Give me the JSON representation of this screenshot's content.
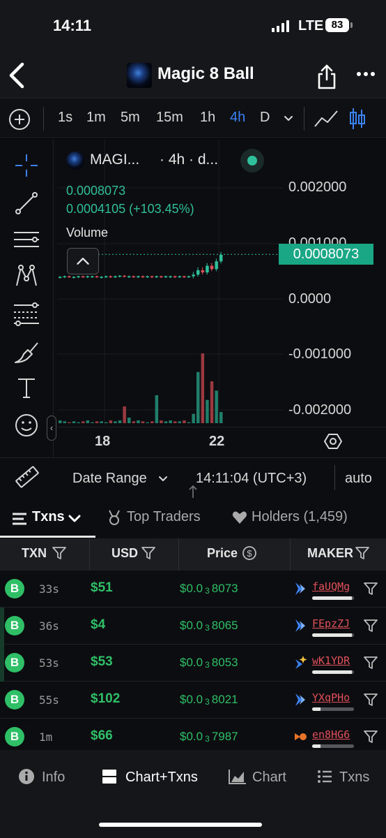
{
  "status_bar": {
    "time": "14:11",
    "network": "LTE",
    "battery": "83"
  },
  "header": {
    "title": "Magic 8 Ball"
  },
  "timeframes": {
    "items": [
      "1s",
      "1m",
      "5m",
      "15m",
      "1h",
      "4h",
      "D"
    ],
    "active": "4h"
  },
  "chart_legend": {
    "symbol": "MAGI...",
    "timeframe_info": "· 4h · d...",
    "price": "0.0008073",
    "change": "0.0004105 (+103.45%)",
    "volume_label": "Volume"
  },
  "chart_data": {
    "type": "candlestick",
    "price_axis_ticks": [
      "0.002000",
      "0.001000",
      "0.0000",
      "-0.001000",
      "-0.002000"
    ],
    "current_price_tag": "0.0008073",
    "x_tick_labels": [
      "18",
      "22"
    ],
    "candles_note": "flat near 0.0004 until date 22, then a spike to 0.0008073",
    "candles": [
      {
        "o": 0.0004,
        "c": 0.0004
      },
      {
        "o": 0.0004,
        "c": 0.00041
      },
      {
        "o": 0.00041,
        "c": 0.0004
      },
      {
        "o": 0.0004,
        "c": 0.0004
      },
      {
        "o": 0.0004,
        "c": 0.00041
      },
      {
        "o": 0.00041,
        "c": 0.0004
      },
      {
        "o": 0.0004,
        "c": 0.00041
      },
      {
        "o": 0.00041,
        "c": 0.00041
      },
      {
        "o": 0.00041,
        "c": 0.0004
      },
      {
        "o": 0.0004,
        "c": 0.0004
      },
      {
        "o": 0.0004,
        "c": 0.00041
      },
      {
        "o": 0.00041,
        "c": 0.0004
      },
      {
        "o": 0.0004,
        "c": 0.00041
      },
      {
        "o": 0.00041,
        "c": 0.00042
      },
      {
        "o": 0.00042,
        "c": 0.00041
      },
      {
        "o": 0.00041,
        "c": 0.00041
      },
      {
        "o": 0.00041,
        "c": 0.0004
      },
      {
        "o": 0.0004,
        "c": 0.00041
      },
      {
        "o": 0.00041,
        "c": 0.0004
      },
      {
        "o": 0.0004,
        "c": 0.00041
      },
      {
        "o": 0.00041,
        "c": 0.0004
      },
      {
        "o": 0.0004,
        "c": 0.00041
      },
      {
        "o": 0.00041,
        "c": 0.0004
      },
      {
        "o": 0.0004,
        "c": 0.00041
      },
      {
        "o": 0.00041,
        "c": 0.00041
      },
      {
        "o": 0.00041,
        "c": 0.0004
      },
      {
        "o": 0.0004,
        "c": 0.00041
      },
      {
        "o": 0.00041,
        "c": 0.0004
      },
      {
        "o": 0.0004,
        "c": 0.00041
      },
      {
        "o": 0.00041,
        "c": 0.00044
      },
      {
        "o": 0.00044,
        "c": 0.00052
      },
      {
        "o": 0.00052,
        "c": 0.00048
      },
      {
        "o": 0.00048,
        "c": 0.0006
      },
      {
        "o": 0.0006,
        "c": 0.00054
      },
      {
        "o": 0.00054,
        "c": 0.00068
      },
      {
        "o": 0.00068,
        "c": 0.0008
      }
    ],
    "volumes": [
      3,
      2,
      1,
      2,
      1,
      2,
      3,
      1,
      2,
      2,
      1,
      3,
      2,
      3,
      18,
      6,
      2,
      3,
      2,
      1,
      2,
      30,
      3,
      2,
      3,
      2,
      2,
      3,
      1,
      10,
      55,
      75,
      25,
      45,
      35,
      12
    ]
  },
  "range_bar": {
    "date_range": "Date Range",
    "clock": "14:11:04 (UTC+3)",
    "scale": "auto"
  },
  "tabs": [
    {
      "label": "Txns"
    },
    {
      "label": "Top Traders"
    },
    {
      "label": "Holders (1,459)"
    }
  ],
  "table": {
    "headers": [
      "TXN",
      "USD",
      "Price",
      "MAKER"
    ],
    "rows": [
      {
        "type": "B",
        "age": "33s",
        "usd": "$51",
        "price_prefix": "$0.0",
        "price_zeros": "3",
        "price_digits": "8073",
        "maker": "faUQMg",
        "maker_icon": "solana-icon",
        "bar": 0.95
      },
      {
        "type": "B",
        "age": "36s",
        "usd": "$4",
        "price_prefix": "$0.0",
        "price_zeros": "3",
        "price_digits": "8065",
        "maker": "FEpzZJ",
        "maker_icon": "solana-icon",
        "bar": 0.95
      },
      {
        "type": "B",
        "age": "53s",
        "usd": "$53",
        "price_prefix": "$0.0",
        "price_zeros": "3",
        "price_digits": "8053",
        "maker": "wK1YDR",
        "maker_icon": "sparkle-icon",
        "bar": 0.95
      },
      {
        "type": "B",
        "age": "55s",
        "usd": "$102",
        "price_prefix": "$0.0",
        "price_zeros": "3",
        "price_digits": "8021",
        "maker": "YXqPHo",
        "maker_icon": "solana-icon",
        "bar": 0.2
      },
      {
        "type": "B",
        "age": "1m",
        "usd": "$66",
        "price_prefix": "$0.0",
        "price_zeros": "3",
        "price_digits": "7987",
        "maker": "en8HG6",
        "maker_icon": "fish-icon",
        "bar": 0.2
      }
    ]
  },
  "bottom_nav": [
    {
      "label": "Info"
    },
    {
      "label": "Chart+Txns"
    },
    {
      "label": "Chart"
    },
    {
      "label": "Txns"
    }
  ],
  "colors": {
    "accent": "#3b82f6",
    "up": "#2fbf9b",
    "buy": "#2fbf67",
    "down": "#e0505a"
  }
}
